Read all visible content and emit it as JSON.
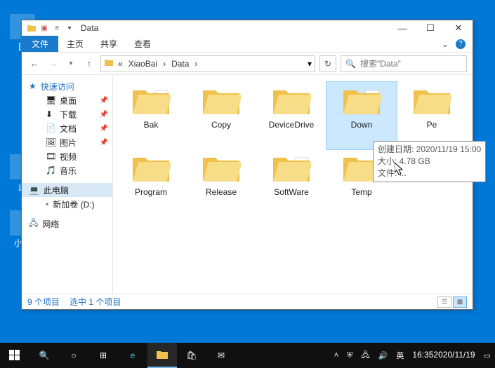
{
  "window": {
    "title": "Data",
    "tabs": {
      "file": "文件",
      "home": "主页",
      "share": "共享",
      "view": "查看"
    },
    "breadcrumb": {
      "prefix": "«",
      "seg1": "XiaoBai",
      "seg2": "Data",
      "drop": "▾",
      "refresh": "↻"
    },
    "search": {
      "placeholder": "搜索\"Data\"",
      "icon": "🔍"
    },
    "controls": {
      "min": "—",
      "max": "☐",
      "close": "✕"
    }
  },
  "nav": {
    "quick": "快速访问",
    "items": [
      {
        "label": "桌面",
        "pin": true
      },
      {
        "label": "下载",
        "pin": true
      },
      {
        "label": "文档",
        "pin": true
      },
      {
        "label": "图片",
        "pin": true
      },
      {
        "label": "视频",
        "pin": false
      },
      {
        "label": "音乐",
        "pin": false
      }
    ],
    "thispc": "此电脑",
    "drive": "新加卷 (D:)",
    "network": "网络"
  },
  "folders": [
    {
      "name": "Bak",
      "overlay": "files"
    },
    {
      "name": "Copy",
      "overlay": "none"
    },
    {
      "name": "DeviceDrive",
      "overlay": "none"
    },
    {
      "name": "Down",
      "overlay": "files",
      "selected": true
    },
    {
      "name": "Pe",
      "overlay": "none"
    },
    {
      "name": "Program",
      "overlay": "none"
    },
    {
      "name": "Release",
      "overlay": "none"
    },
    {
      "name": "SoftWare",
      "overlay": "files"
    },
    {
      "name": "Temp",
      "overlay": "none"
    }
  ],
  "tooltip": {
    "l1": "创建日期: 2020/11/19 15:00",
    "l2": "大小: 4.78 GB",
    "l3": "文件: ..."
  },
  "status": {
    "count": "9 个项目",
    "selected": "选中 1 个项目"
  },
  "desktop": {
    "label1": "回",
    "label2": "此",
    "label3": "小白"
  },
  "taskbar": {
    "time": "16:35",
    "date": "2020/11/19",
    "ime": "英"
  }
}
